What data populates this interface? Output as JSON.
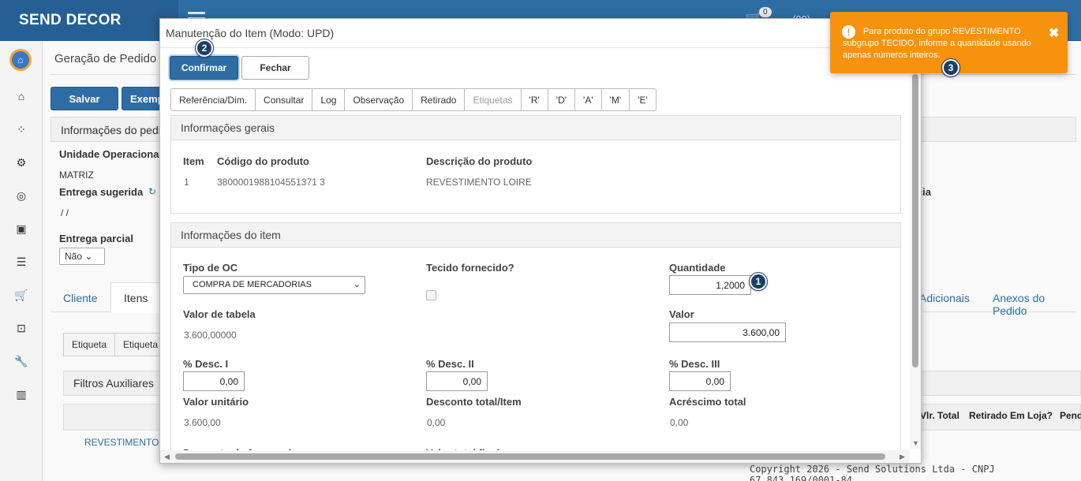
{
  "app": {
    "brand": "SEND DECOR",
    "cart_count": "0",
    "user_fragment": "(00)"
  },
  "background": {
    "page_title": "Geração de Pedido",
    "buttons": {
      "save": "Salvar",
      "example": "Exemp"
    },
    "info_header": "Informações do pedi",
    "unit_label": "Unidade Operacional",
    "unit_value": "MATRIZ",
    "suggested_delivery_label": "Entrega sugerida",
    "suggested_delivery_value": "/ /",
    "partial_delivery_label": "Entrega parcial",
    "partial_delivery_value": "Não",
    "right_label_fragment": "ncia",
    "tabs": {
      "client": "Cliente",
      "items": "Itens",
      "additional": "Adicionais",
      "attachments": "Anexos do Pedido"
    },
    "sub_buttons": {
      "label1": "Etiqueta",
      "label2": "Etiqueta"
    },
    "filters": "Filtros Auxiliares",
    "table_headers": {
      "total": "Vlr. Total",
      "picked": "Retirado Em Loja?",
      "pending": "Pend"
    },
    "row_product": "REVESTIMENTO LO",
    "footer": "Copyright 2026 - Send Solutions Ltda - CNPJ 67.843.169/0001-84"
  },
  "modal": {
    "title": "Manutenção do Item (Modo: UPD)",
    "confirm_label": "Confirmar",
    "close_label": "Fechar",
    "tabs": [
      "Referência/Dim.",
      "Consultar",
      "Log",
      "Observação",
      "Retirado",
      "Etiquetas",
      "'R'",
      "'D'",
      "'A'",
      "'M'",
      "'E'"
    ],
    "general": {
      "header": "Informações gerais",
      "item_label": "Item",
      "item_value": "1",
      "code_label": "Código do produto",
      "code_value": "3800001988104551371 3",
      "desc_label": "Descrição do produto",
      "desc_value": "REVESTIMENTO LOIRE"
    },
    "item_info": {
      "header": "Informações do item",
      "oc_type_label": "Tipo de OC",
      "oc_type_value": "COMPRA DE MERCADORIAS",
      "fabric_label": "Tecido fornecido?",
      "quantity_label": "Quantidade",
      "quantity_value": "1,2000",
      "table_value_label": "Valor de tabela",
      "table_value": "3.600,00000",
      "value_label": "Valor",
      "value_value": "3.600,00",
      "disc1_label": "% Desc. I",
      "disc1_value": "0,00",
      "disc2_label": "% Desc. II",
      "disc2_value": "0,00",
      "disc3_label": "% Desc. III",
      "disc3_value": "0,00",
      "unit_value_label": "Valor unitário",
      "unit_value": "3.600,00",
      "total_discount_label": "Desconto total/Item",
      "total_discount_value": "0,00",
      "total_increase_label": "Acréscimo total",
      "total_increase_value": "0,00",
      "supplier_discount_label": "Desconto do fornecedor",
      "final_total_label": "Valor total final"
    }
  },
  "steps": [
    "1",
    "2",
    "3"
  ],
  "toast": {
    "message": "Para produto do grupo REVESTIMENTO subgrupo TECIDO, informe a quantidade usando apenas números inteiros.",
    "icon": "!",
    "close": "✖",
    "color": "#f7920f"
  }
}
